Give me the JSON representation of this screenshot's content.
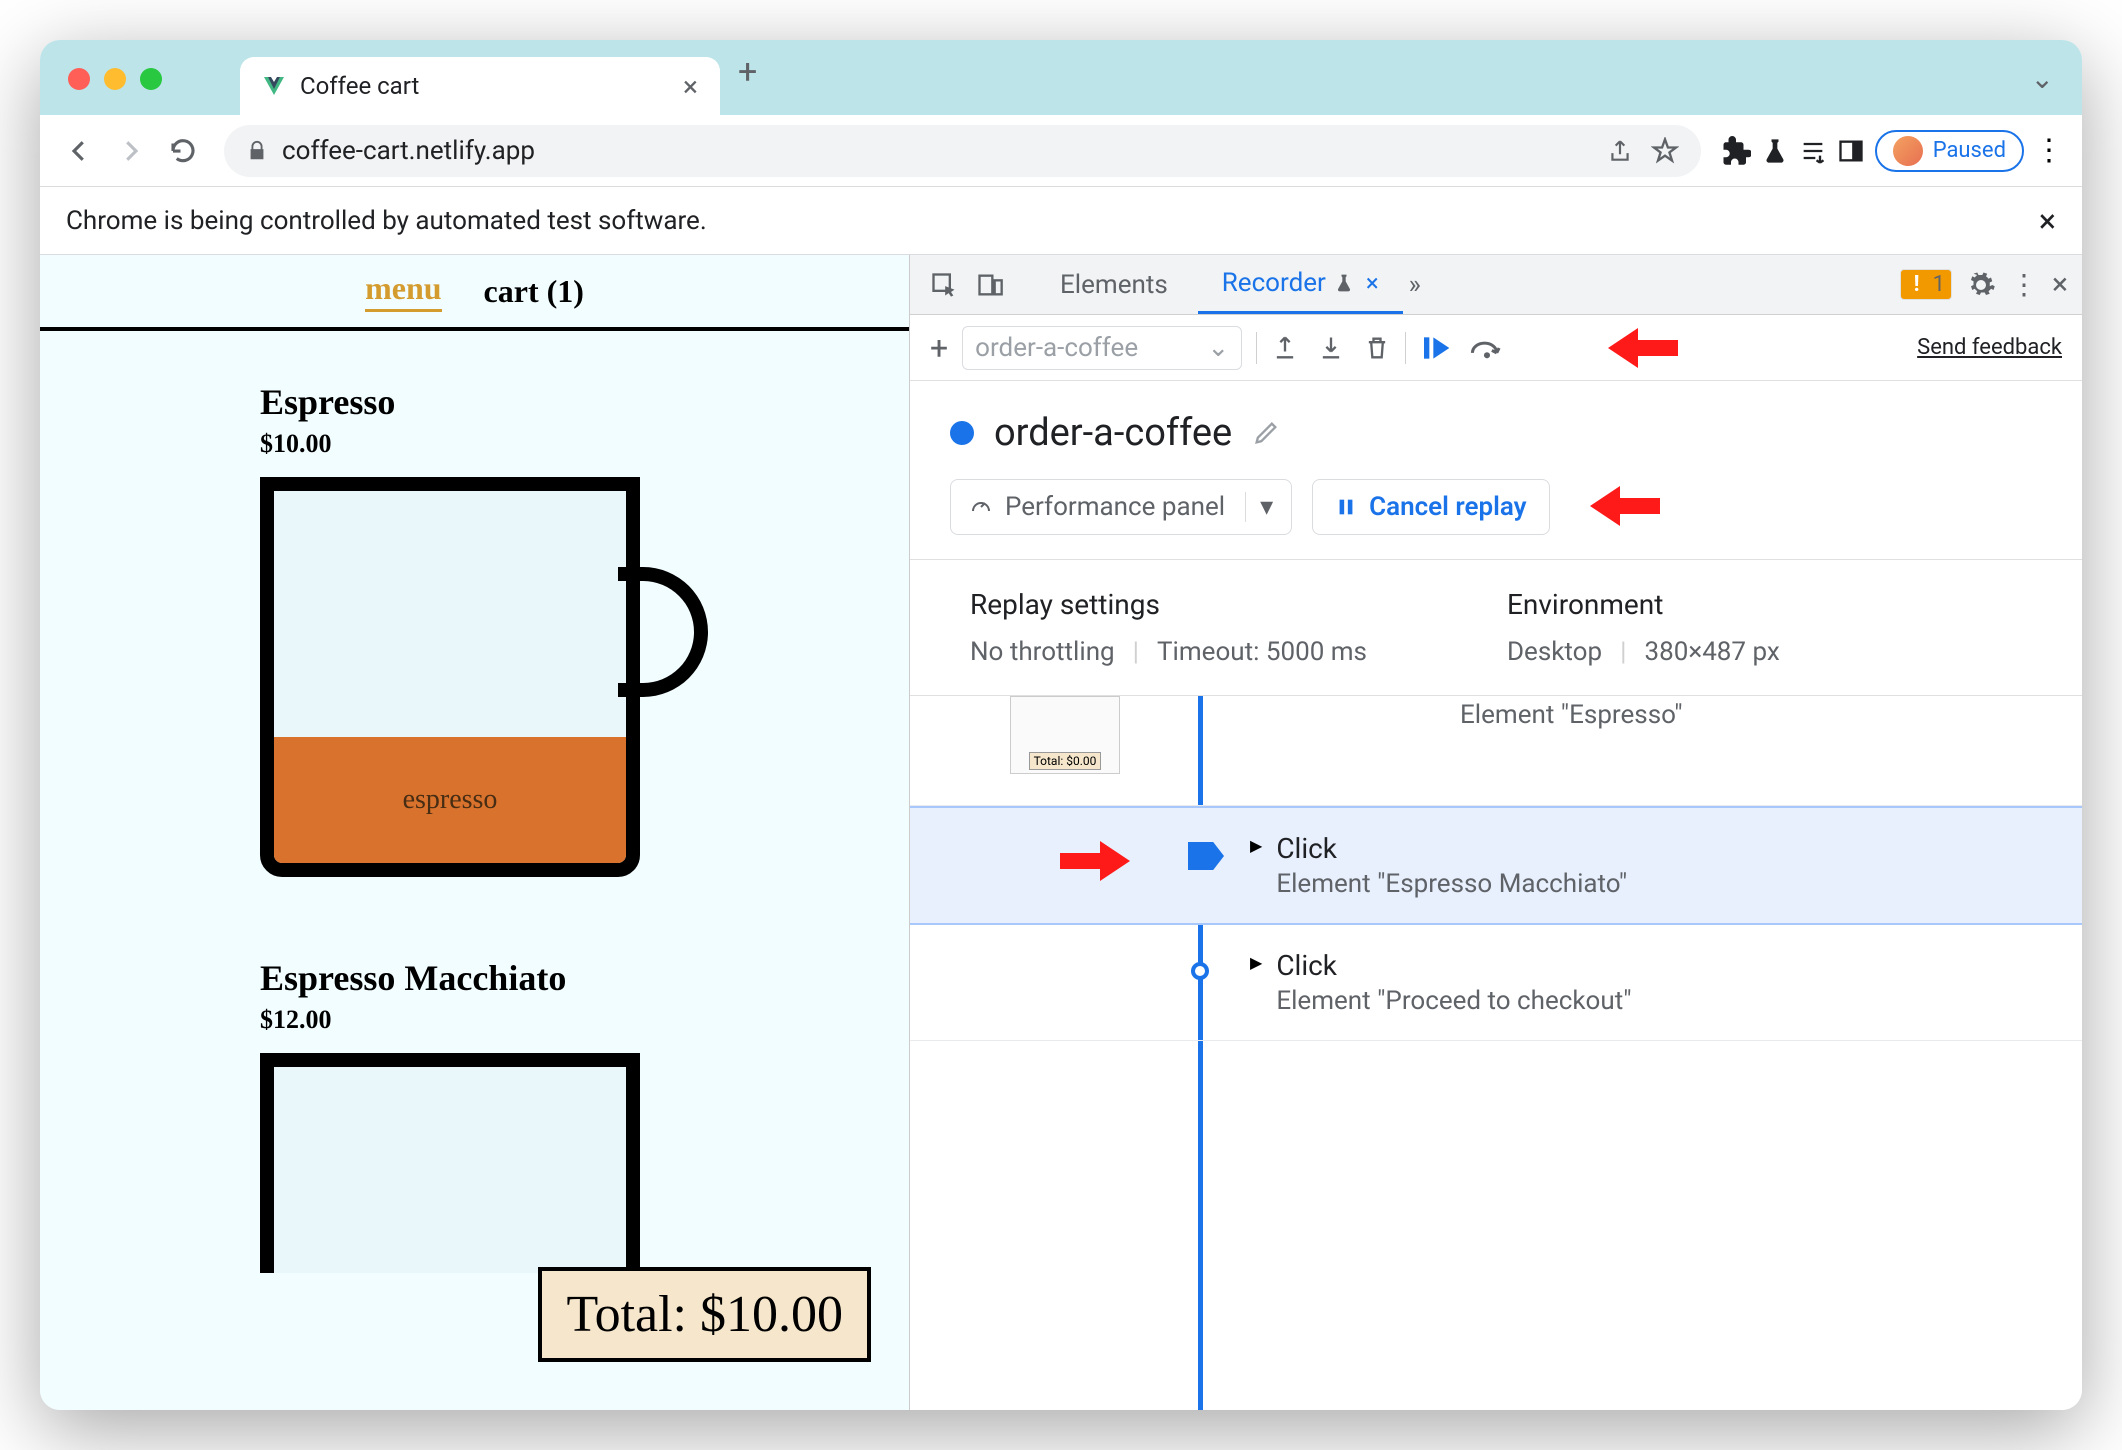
{
  "browser": {
    "tab_title": "Coffee cart",
    "url": "coffee-cart.netlify.app",
    "paused_label": "Paused",
    "banner": "Chrome is being controlled by automated test software."
  },
  "page": {
    "nav": {
      "menu": "menu",
      "cart": "cart (1)"
    },
    "product1": {
      "title": "Espresso",
      "price": "$10.00",
      "fill_label": "espresso"
    },
    "product2": {
      "title": "Espresso Macchiato",
      "price": "$12.00"
    },
    "total": "Total: $10.00"
  },
  "devtools": {
    "tabs": {
      "elements": "Elements",
      "recorder": "Recorder"
    },
    "issues_count": "1",
    "toolbar": {
      "recording_placeholder": "order-a-coffee",
      "send_feedback": "Send feedback"
    },
    "recording": {
      "name": "order-a-coffee",
      "perf_panel": "Performance panel",
      "cancel_replay": "Cancel replay"
    },
    "settings": {
      "replay_title": "Replay settings",
      "throttling": "No throttling",
      "timeout": "Timeout: 5000 ms",
      "env_title": "Environment",
      "device": "Desktop",
      "viewport": "380×487 px"
    },
    "steps": {
      "s1_sub": "Element \"Espresso\"",
      "s1_thumb": "Total: $0.00",
      "s2_title": "Click",
      "s2_sub": "Element \"Espresso Macchiato\"",
      "s3_title": "Click",
      "s3_sub": "Element \"Proceed to checkout\""
    }
  }
}
